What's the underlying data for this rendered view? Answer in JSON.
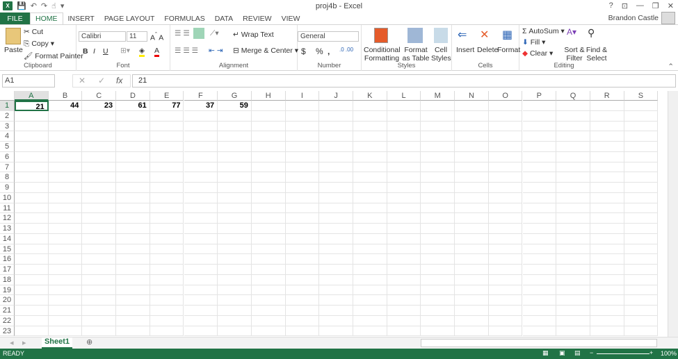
{
  "window": {
    "title": "proj4b - Excel",
    "user": "Brandon Castle"
  },
  "tabs": [
    "FILE",
    "HOME",
    "INSERT",
    "PAGE LAYOUT",
    "FORMULAS",
    "DATA",
    "REVIEW",
    "VIEW"
  ],
  "ribbon": {
    "clipboard": {
      "label": "Clipboard",
      "paste": "Paste",
      "cut": "Cut",
      "copy": "Copy",
      "format_painter": "Format Painter"
    },
    "font": {
      "label": "Font",
      "family": "Calibri",
      "size": "11",
      "bold": "B",
      "italic": "I",
      "underline": "U"
    },
    "alignment": {
      "label": "Alignment",
      "wrap": "Wrap Text",
      "merge": "Merge & Center"
    },
    "number": {
      "label": "Number",
      "format": "General",
      "currency": "$",
      "percent": "%",
      "comma": ","
    },
    "styles": {
      "label": "Styles",
      "conditional": "Conditional Formatting",
      "format_table": "Format as Table",
      "cell_styles": "Cell Styles"
    },
    "cells": {
      "label": "Cells",
      "insert": "Insert",
      "delete": "Delete",
      "format": "Format"
    },
    "editing": {
      "label": "Editing",
      "autosum": "AutoSum",
      "fill": "Fill",
      "clear": "Clear",
      "sort": "Sort & Filter",
      "find": "Find & Select"
    }
  },
  "formula_bar": {
    "name_box": "A1",
    "fx": "fx",
    "value": "21"
  },
  "sheet": {
    "columns": [
      "A",
      "B",
      "C",
      "D",
      "E",
      "F",
      "G",
      "H",
      "I",
      "J",
      "K",
      "L",
      "M",
      "N",
      "O",
      "P",
      "Q",
      "R",
      "S"
    ],
    "rows": [
      "1",
      "2",
      "3",
      "4",
      "5",
      "6",
      "7",
      "8",
      "9",
      "10",
      "11",
      "12",
      "13",
      "14",
      "15",
      "16",
      "17",
      "18",
      "19",
      "20",
      "21",
      "22",
      "23"
    ],
    "row1": [
      "21",
      "44",
      "23",
      "61",
      "77",
      "37",
      "59"
    ],
    "selected": "A1"
  },
  "sheet_tabs": [
    "Sheet1"
  ],
  "status": {
    "text": "READY",
    "zoom": "100%"
  }
}
